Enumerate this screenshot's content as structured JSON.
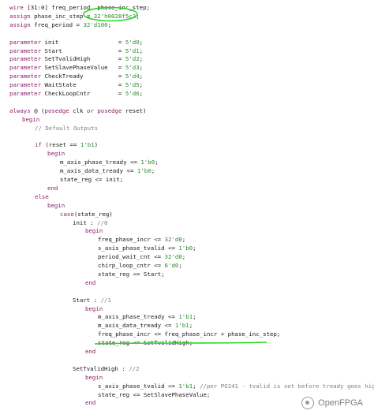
{
  "colors": {
    "keyword": "#8a1f6b",
    "comment": "#808080",
    "number": "#2c8a2c",
    "text": "#1a1a1a",
    "annotation_green": "#27d827"
  },
  "code_lines": [
    {
      "indent": 0,
      "parts": [
        [
          "kw",
          "wire"
        ],
        [
          "id",
          " [31:0] freq_period, phase_inc_step;"
        ]
      ]
    },
    {
      "indent": 0,
      "parts": [
        [
          "kw",
          "assign"
        ],
        [
          "id",
          " phase_inc_step = "
        ],
        [
          "num",
          "32'h0028f5c2"
        ],
        [
          "id",
          ";"
        ]
      ]
    },
    {
      "indent": 0,
      "parts": [
        [
          "kw",
          "assign"
        ],
        [
          "id",
          " freq_period = "
        ],
        [
          "num",
          "32'd100"
        ],
        [
          "id",
          ";"
        ]
      ]
    },
    {
      "indent": 0,
      "parts": []
    },
    {
      "indent": 0,
      "parts": [
        [
          "kw",
          "parameter"
        ],
        [
          "id",
          " init                 = "
        ],
        [
          "num",
          "5'd0"
        ],
        [
          "id",
          ";"
        ]
      ]
    },
    {
      "indent": 0,
      "parts": [
        [
          "kw",
          "parameter"
        ],
        [
          "id",
          " Start                = "
        ],
        [
          "num",
          "5'd1"
        ],
        [
          "id",
          ";"
        ]
      ]
    },
    {
      "indent": 0,
      "parts": [
        [
          "kw",
          "parameter"
        ],
        [
          "id",
          " SetTvalidHigh        = "
        ],
        [
          "num",
          "5'd2"
        ],
        [
          "id",
          ";"
        ]
      ]
    },
    {
      "indent": 0,
      "parts": [
        [
          "kw",
          "parameter"
        ],
        [
          "id",
          " SetSlavePhaseValue   = "
        ],
        [
          "num",
          "5'd3"
        ],
        [
          "id",
          ";"
        ]
      ]
    },
    {
      "indent": 0,
      "parts": [
        [
          "kw",
          "parameter"
        ],
        [
          "id",
          " CheckTready          = "
        ],
        [
          "num",
          "5'd4"
        ],
        [
          "id",
          ";"
        ]
      ]
    },
    {
      "indent": 0,
      "parts": [
        [
          "kw",
          "parameter"
        ],
        [
          "id",
          " WaitState            = "
        ],
        [
          "num",
          "5'd5"
        ],
        [
          "id",
          ";"
        ]
      ]
    },
    {
      "indent": 0,
      "parts": [
        [
          "kw",
          "parameter"
        ],
        [
          "id",
          " CheckLoopCntr        = "
        ],
        [
          "num",
          "5'd6"
        ],
        [
          "id",
          ";"
        ]
      ]
    },
    {
      "indent": 0,
      "parts": []
    },
    {
      "indent": 0,
      "parts": [
        [
          "kw",
          "always"
        ],
        [
          "id",
          " @ ("
        ],
        [
          "kw",
          "posedge"
        ],
        [
          "id",
          " clk "
        ],
        [
          "kw",
          "or"
        ],
        [
          "id",
          " "
        ],
        [
          "kw",
          "posedge"
        ],
        [
          "id",
          " reset)"
        ]
      ]
    },
    {
      "indent": 1,
      "parts": [
        [
          "kw",
          "begin"
        ]
      ]
    },
    {
      "indent": 2,
      "parts": [
        [
          "cm",
          "// Default Outputs"
        ]
      ]
    },
    {
      "indent": 0,
      "parts": []
    },
    {
      "indent": 2,
      "parts": [
        [
          "kw",
          "if"
        ],
        [
          "id",
          " (reset == "
        ],
        [
          "num",
          "1'b1"
        ],
        [
          "id",
          ")"
        ]
      ]
    },
    {
      "indent": 3,
      "parts": [
        [
          "kw",
          "begin"
        ]
      ]
    },
    {
      "indent": 4,
      "parts": [
        [
          "id",
          "m_axis_phase_tready <= "
        ],
        [
          "num",
          "1'b0"
        ],
        [
          "id",
          ";"
        ]
      ]
    },
    {
      "indent": 4,
      "parts": [
        [
          "id",
          "m_axis_data_tready <= "
        ],
        [
          "num",
          "1'b0"
        ],
        [
          "id",
          ";"
        ]
      ]
    },
    {
      "indent": 4,
      "parts": [
        [
          "id",
          "state_reg <= init;"
        ]
      ]
    },
    {
      "indent": 3,
      "parts": [
        [
          "kw",
          "end"
        ]
      ]
    },
    {
      "indent": 2,
      "parts": [
        [
          "kw",
          "else"
        ]
      ]
    },
    {
      "indent": 3,
      "parts": [
        [
          "kw",
          "begin"
        ]
      ]
    },
    {
      "indent": 4,
      "parts": [
        [
          "kw",
          "case"
        ],
        [
          "id",
          "(state_reg)"
        ]
      ]
    },
    {
      "indent": 5,
      "parts": [
        [
          "id",
          "init : "
        ],
        [
          "cm",
          "//0"
        ]
      ]
    },
    {
      "indent": 6,
      "parts": [
        [
          "kw",
          "begin"
        ]
      ]
    },
    {
      "indent": 7,
      "parts": [
        [
          "id",
          "freq_phase_incr <= "
        ],
        [
          "num",
          "32'd0"
        ],
        [
          "id",
          ";"
        ]
      ]
    },
    {
      "indent": 7,
      "parts": [
        [
          "id",
          "s_axis_phase_tvalid <= "
        ],
        [
          "num",
          "1'b0"
        ],
        [
          "id",
          ";"
        ]
      ]
    },
    {
      "indent": 7,
      "parts": [
        [
          "id",
          "period_wait_cnt <= "
        ],
        [
          "num",
          "32'd0"
        ],
        [
          "id",
          ";"
        ]
      ]
    },
    {
      "indent": 7,
      "parts": [
        [
          "id",
          "chirp_loop_cntr <= "
        ],
        [
          "num",
          "6'd0"
        ],
        [
          "id",
          ";"
        ]
      ]
    },
    {
      "indent": 7,
      "parts": [
        [
          "id",
          "state_reg <= Start;"
        ]
      ]
    },
    {
      "indent": 6,
      "parts": [
        [
          "kw",
          "end"
        ]
      ]
    },
    {
      "indent": 0,
      "parts": []
    },
    {
      "indent": 5,
      "parts": [
        [
          "id",
          "Start : "
        ],
        [
          "cm",
          "//1"
        ]
      ]
    },
    {
      "indent": 6,
      "parts": [
        [
          "kw",
          "begin"
        ]
      ]
    },
    {
      "indent": 7,
      "parts": [
        [
          "id",
          "m_axis_phase_tready <= "
        ],
        [
          "num",
          "1'b1"
        ],
        [
          "id",
          ";"
        ]
      ]
    },
    {
      "indent": 7,
      "parts": [
        [
          "id",
          "m_axis_data_tready <= "
        ],
        [
          "num",
          "1'b1"
        ],
        [
          "id",
          ";"
        ]
      ]
    },
    {
      "indent": 7,
      "parts": [
        [
          "id",
          "freq_phase_incr <= freq_phase_incr + phase_inc_step;"
        ]
      ]
    },
    {
      "indent": 7,
      "parts": [
        [
          "id",
          "state_reg <= SetTvalidHigh;"
        ]
      ]
    },
    {
      "indent": 6,
      "parts": [
        [
          "kw",
          "end"
        ]
      ]
    },
    {
      "indent": 0,
      "parts": []
    },
    {
      "indent": 5,
      "parts": [
        [
          "id",
          "SetTvalidHigh : "
        ],
        [
          "cm",
          "//2"
        ]
      ]
    },
    {
      "indent": 6,
      "parts": [
        [
          "kw",
          "begin"
        ]
      ]
    },
    {
      "indent": 7,
      "parts": [
        [
          "id",
          "s_axis_phase_tvalid <= "
        ],
        [
          "num",
          "1'b1"
        ],
        [
          "id",
          "; "
        ],
        [
          "cm",
          "//per PG141 - tvalid is set before tready goes high"
        ]
      ]
    },
    {
      "indent": 7,
      "parts": [
        [
          "id",
          "state_reg <= SetSlavePhaseValue;"
        ]
      ]
    },
    {
      "indent": 6,
      "parts": [
        [
          "kw",
          "end"
        ]
      ]
    }
  ],
  "watermark": {
    "icon": "openfpga-logo-icon",
    "text": "OpenFPGA"
  }
}
